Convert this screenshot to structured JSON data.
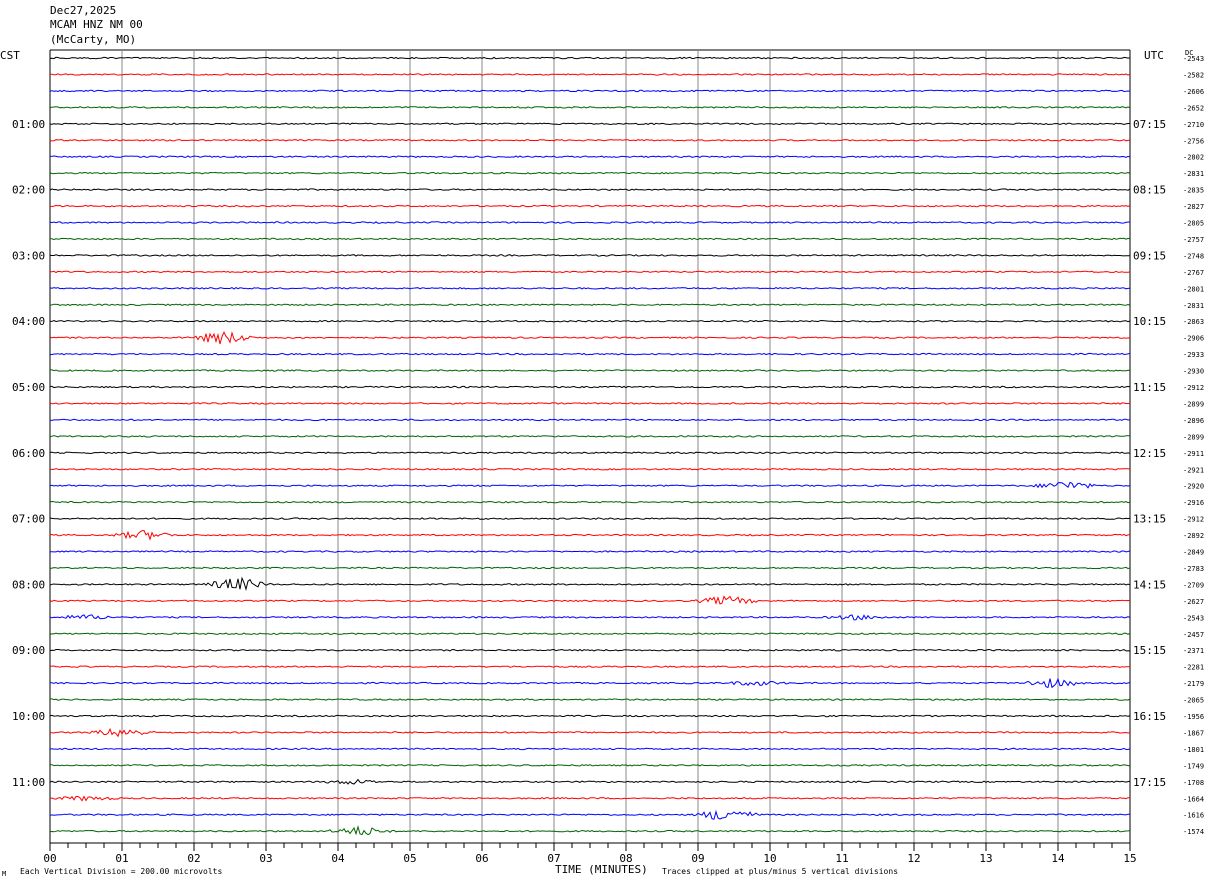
{
  "header": {
    "date": "Dec27,2025",
    "station": "MCAM HNZ NM 00",
    "location": "(McCarty, MO)"
  },
  "left_timezone": "CST",
  "right_timezone": "UTC",
  "dc_label": "DC",
  "footer": {
    "scale_note": "Each Vertical Division =  200.00 microvolts",
    "clip_note": "Traces clipped at plus/minus 5 vertical divisions",
    "corner_mark": "M"
  },
  "chart_data": {
    "type": "line",
    "title": "",
    "xlabel": "TIME (MINUTES)",
    "ylabel": "",
    "xlim": [
      0,
      15
    ],
    "x_ticks": [
      "00",
      "01",
      "02",
      "03",
      "04",
      "05",
      "06",
      "07",
      "08",
      "09",
      "10",
      "11",
      "12",
      "13",
      "14",
      "15"
    ],
    "grid": true,
    "trace_colors": [
      "#000000",
      "#ff0000",
      "#0000ff",
      "#006400"
    ],
    "left_hour_labels": [
      "01:00",
      "02:00",
      "03:00",
      "04:00",
      "05:00",
      "06:00",
      "07:00",
      "08:00",
      "09:00",
      "10:00",
      "11:00"
    ],
    "right_hour_labels": [
      "07:15",
      "08:15",
      "09:15",
      "10:15",
      "11:15",
      "12:15",
      "13:15",
      "14:15",
      "15:15",
      "16:15",
      "17:15"
    ],
    "dc_offsets": [
      -2543,
      -2582,
      -2606,
      -2652,
      -2710,
      -2756,
      -2802,
      -2831,
      -2835,
      -2827,
      -2805,
      -2757,
      -2748,
      -2767,
      -2801,
      -2831,
      -2863,
      -2906,
      -2933,
      -2930,
      -2912,
      -2899,
      -2896,
      -2899,
      -2911,
      -2921,
      -2920,
      -2916,
      -2912,
      -2892,
      -2849,
      -2783,
      -2709,
      -2627,
      -2543,
      -2457,
      -2371,
      -2281,
      -2179,
      -2065,
      -1956,
      -1867,
      -1801,
      -1749,
      -1708,
      -1664,
      -1616,
      -1574
    ],
    "events": [
      {
        "trace": 17,
        "minute": 2.4,
        "amplitude": 3
      },
      {
        "trace": 26,
        "minute": 14.1,
        "amplitude": 2
      },
      {
        "trace": 29,
        "minute": 1.3,
        "amplitude": 2
      },
      {
        "trace": 32,
        "minute": 2.6,
        "amplitude": 3
      },
      {
        "trace": 33,
        "minute": 9.4,
        "amplitude": 2
      },
      {
        "trace": 34,
        "minute": 0.5,
        "amplitude": 1
      },
      {
        "trace": 34,
        "minute": 11.2,
        "amplitude": 1
      },
      {
        "trace": 38,
        "minute": 9.8,
        "amplitude": 1
      },
      {
        "trace": 38,
        "minute": 13.9,
        "amplitude": 2
      },
      {
        "trace": 41,
        "minute": 1.0,
        "amplitude": 2
      },
      {
        "trace": 44,
        "minute": 4.2,
        "amplitude": 1
      },
      {
        "trace": 45,
        "minute": 0.5,
        "amplitude": 1
      },
      {
        "trace": 46,
        "minute": 9.4,
        "amplitude": 3
      },
      {
        "trace": 47,
        "minute": 4.3,
        "amplitude": 2
      }
    ]
  }
}
